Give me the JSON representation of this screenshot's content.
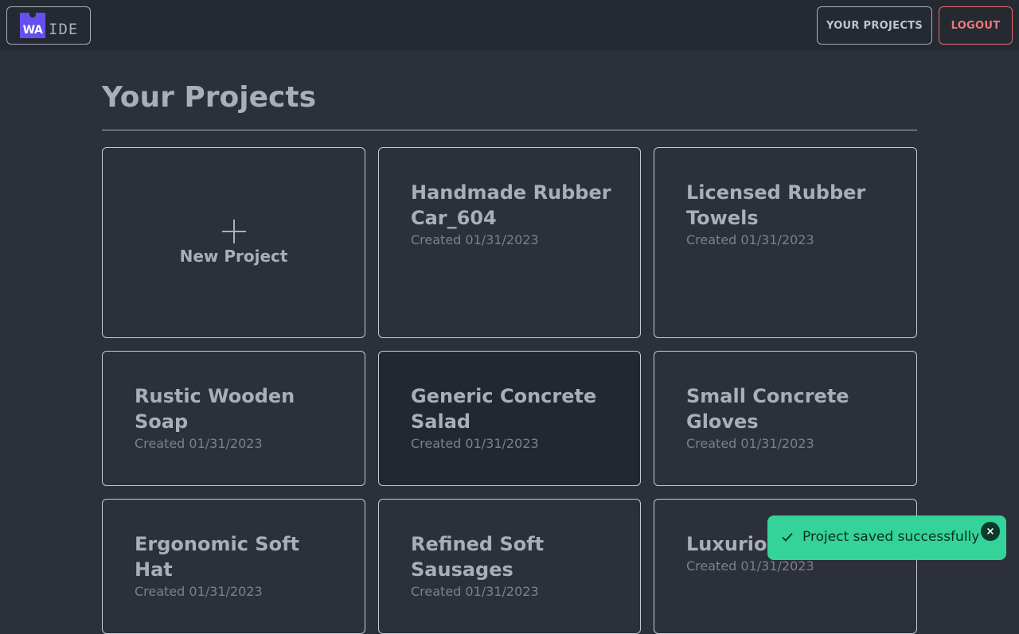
{
  "header": {
    "logo_mark": "WA",
    "logo_text": "IDE",
    "your_projects_label": "YOUR PROJECTS",
    "logout_label": "LOGOUT"
  },
  "main": {
    "title": "Your Projects",
    "new_project_label": "New Project",
    "projects": [
      {
        "name": "Handmade Rubber Car_604",
        "created": "Created 01/31/2023"
      },
      {
        "name": "Licensed Rubber Towels",
        "created": "Created 01/31/2023"
      },
      {
        "name": "Rustic Wooden Soap",
        "created": "Created 01/31/2023"
      },
      {
        "name": "Generic Concrete Salad",
        "created": "Created 01/31/2023"
      },
      {
        "name": "Small Concrete Gloves",
        "created": "Created 01/31/2023"
      },
      {
        "name": "Ergonomic Soft Hat",
        "created": "Created 01/31/2023"
      },
      {
        "name": "Refined Soft Sausages",
        "created": "Created 01/31/2023"
      },
      {
        "name": "Luxurious Table",
        "created": "Created 01/31/2023"
      }
    ]
  },
  "toast": {
    "message": "Project saved successfully",
    "close_glyph": "×",
    "icon": "check-icon"
  },
  "colors": {
    "background": "#2b303b",
    "topbar": "#252932",
    "brand": "#654ff0",
    "logout": "#f07878",
    "toast": "#34d399"
  }
}
